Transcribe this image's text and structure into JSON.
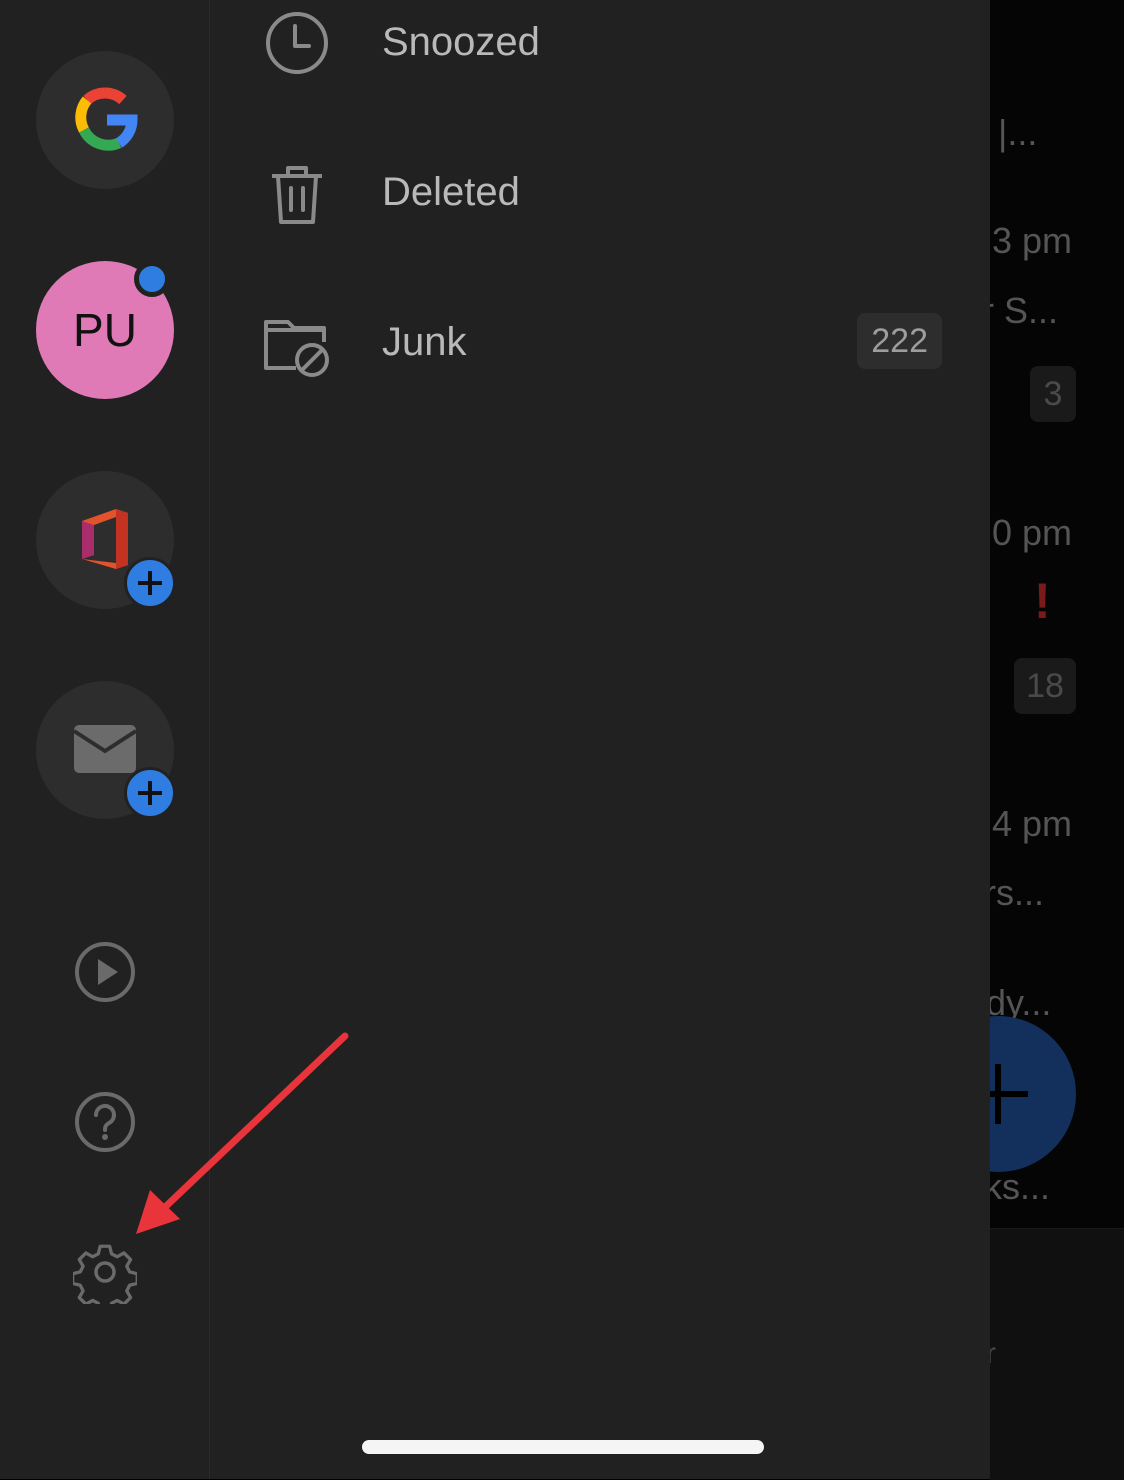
{
  "background_list": {
    "fragments": [
      "s |...",
      "3 pm",
      "r S...",
      "0 pm",
      "4 pm",
      "rs...",
      "dy...",
      "ks...",
      "r"
    ],
    "badges": [
      "3",
      "18"
    ]
  },
  "rail": {
    "accounts": [
      {
        "name": "google-account",
        "initials": ""
      },
      {
        "name": "pu-account",
        "initials": "PU",
        "unread_dot": true
      },
      {
        "name": "office-account-add"
      },
      {
        "name": "mail-account-add"
      }
    ],
    "icons": [
      "play-icon",
      "help-icon",
      "gear-icon"
    ]
  },
  "folders": [
    {
      "label": "Snoozed",
      "icon": "clock-icon",
      "count": ""
    },
    {
      "label": "Deleted",
      "icon": "trash-icon",
      "count": ""
    },
    {
      "label": "Junk",
      "icon": "junk-folder-icon",
      "count": "222"
    }
  ],
  "colors": {
    "drawer_bg": "#212121",
    "accent_blue": "#2f7de1",
    "pu_avatar": "#e07ab7",
    "annotation_arrow": "#e8343a"
  }
}
